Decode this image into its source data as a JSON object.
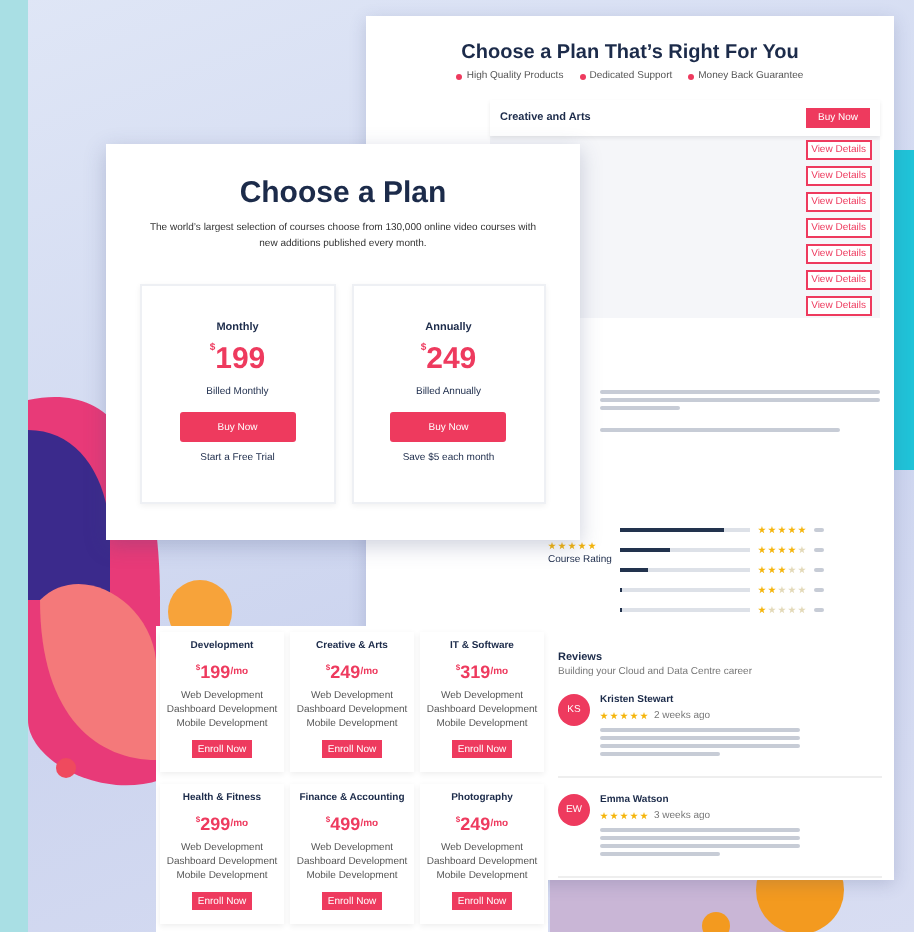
{
  "back_page": {
    "title": "Choose a Plan That’s Right For You",
    "features": [
      "High Quality Products",
      "Dedicated Support",
      "Money Back Guarantee"
    ],
    "plan_panel": {
      "title": "Creative and Arts",
      "buy_button": "Buy Now",
      "rows": [
        "View Details",
        "View Details",
        "View Details",
        "View Details",
        "View Details",
        "View Details",
        "View Details"
      ]
    },
    "rating": {
      "stars": 5,
      "label": "Course Rating",
      "bars": [
        {
          "level": 0.8,
          "stars": 5
        },
        {
          "level": 0.38,
          "stars": 4
        },
        {
          "level": 0.22,
          "stars": 3
        },
        {
          "level": 0.02,
          "stars": 2
        },
        {
          "level": 0.02,
          "stars": 1
        }
      ]
    },
    "reviews": {
      "title": "Reviews",
      "subtitle": "Building your Cloud and Data Centre career",
      "items": [
        {
          "initials": "KS",
          "name": "Kristen Stewart",
          "stars": 5,
          "time": "2 weeks ago"
        },
        {
          "initials": "EW",
          "name": "Emma Watson",
          "stars": 5,
          "time": "3 weeks ago"
        }
      ]
    }
  },
  "plan_card": {
    "title": "Choose a Plan",
    "subtitle": "The world’s largest selection of courses choose from 130,000 online video courses with new additions published every month.",
    "plans": [
      {
        "name": "Monthly",
        "currency": "$",
        "price": "199",
        "billing": "Billed Monthly",
        "button": "Buy Now",
        "note": "Start a Free Trial"
      },
      {
        "name": "Annually",
        "currency": "$",
        "price": "249",
        "billing": "Billed Annually",
        "button": "Buy Now",
        "note": "Save $5 each month"
      }
    ]
  },
  "course_grid": {
    "courses": [
      {
        "name": "Development",
        "currency": "$",
        "price": "199",
        "period": "/mo",
        "features": [
          "Web Development",
          "Dashboard Development",
          "Mobile Development"
        ],
        "button": "Enroll Now"
      },
      {
        "name": "Creative & Arts",
        "currency": "$",
        "price": "249",
        "period": "/mo",
        "features": [
          "Web Development",
          "Dashboard Development",
          "Mobile Development"
        ],
        "button": "Enroll Now"
      },
      {
        "name": "IT & Software",
        "currency": "$",
        "price": "319",
        "period": "/mo",
        "features": [
          "Web Development",
          "Dashboard Development",
          "Mobile Development"
        ],
        "button": "Enroll Now"
      },
      {
        "name": "Health & Fitness",
        "currency": "$",
        "price": "299",
        "period": "/mo",
        "features": [
          "Web Development",
          "Dashboard Development",
          "Mobile Development"
        ],
        "button": "Enroll Now"
      },
      {
        "name": "Finance & Accounting",
        "currency": "$",
        "price": "499",
        "period": "/mo",
        "features": [
          "Web Development",
          "Dashboard Development",
          "Mobile Development"
        ],
        "button": "Enroll Now"
      },
      {
        "name": "Photography",
        "currency": "$",
        "price": "249",
        "period": "/mo",
        "features": [
          "Web Development",
          "Dashboard Development",
          "Mobile Development"
        ],
        "button": "Enroll Now"
      }
    ]
  }
}
